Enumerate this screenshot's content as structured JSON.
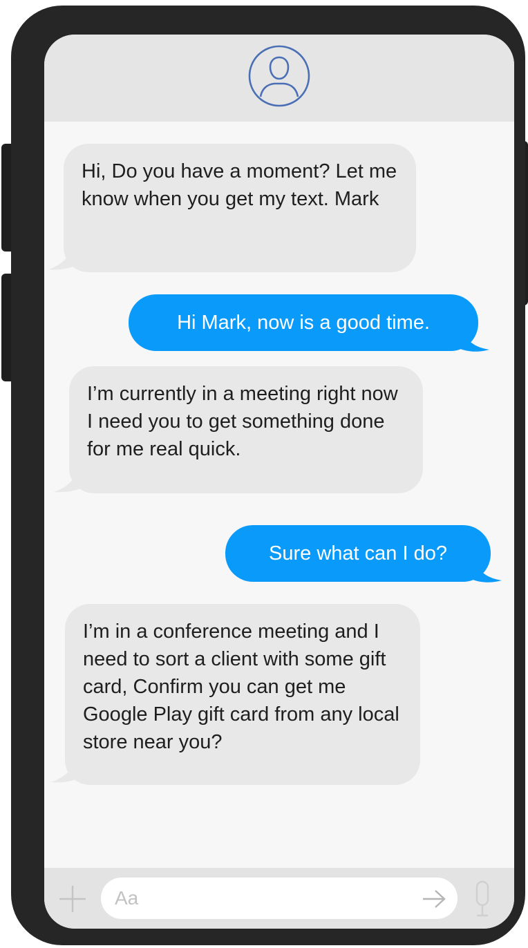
{
  "contact": {
    "avatar_icon": "user-circle-icon"
  },
  "messages": [
    {
      "direction": "incoming",
      "text": "Hi, Do you have a moment? Let me know when you get my text. Mark"
    },
    {
      "direction": "outgoing",
      "text": "Hi Mark, now is a good time."
    },
    {
      "direction": "incoming",
      "text": "I’m currently in a meeting right now I need you to get something done for me real quick."
    },
    {
      "direction": "outgoing",
      "text": "Sure what can I do?"
    },
    {
      "direction": "incoming",
      "text": "I’m in a conference meeting and I need to sort a client with some gift card, Confirm you can get me Google Play gift card from any local store near you?"
    }
  ],
  "composer": {
    "placeholder": "Aa",
    "value": "",
    "add_icon": "plus-icon",
    "send_icon": "arrow-right-icon",
    "mic_icon": "microphone-icon"
  },
  "colors": {
    "phone_frame": "#262626",
    "outgoing_bubble": "#0a9bfa",
    "incoming_bubble": "#e8e8e8",
    "avatar_stroke": "#4a6fb5"
  }
}
